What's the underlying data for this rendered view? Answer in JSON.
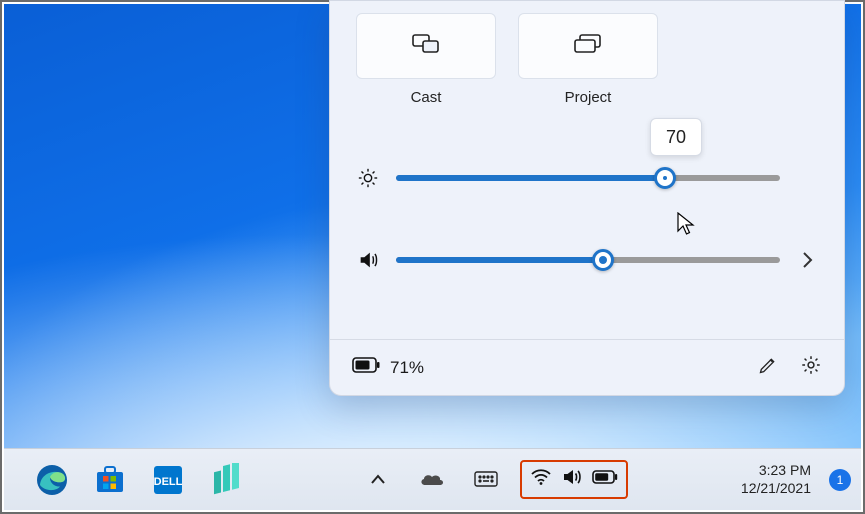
{
  "panel": {
    "tiles": {
      "cast": {
        "label": "Cast"
      },
      "project": {
        "label": "Project"
      }
    },
    "brightness": {
      "value": 70,
      "tooltip": "70"
    },
    "volume": {
      "value": 54
    },
    "footer": {
      "battery_text": "71%"
    }
  },
  "taskbar": {
    "datetime": {
      "time": "3:23 PM",
      "date": "12/21/2021"
    },
    "notification_count": "1"
  },
  "colors": {
    "accent": "#1f74c9",
    "annotation": "#d83b01"
  }
}
